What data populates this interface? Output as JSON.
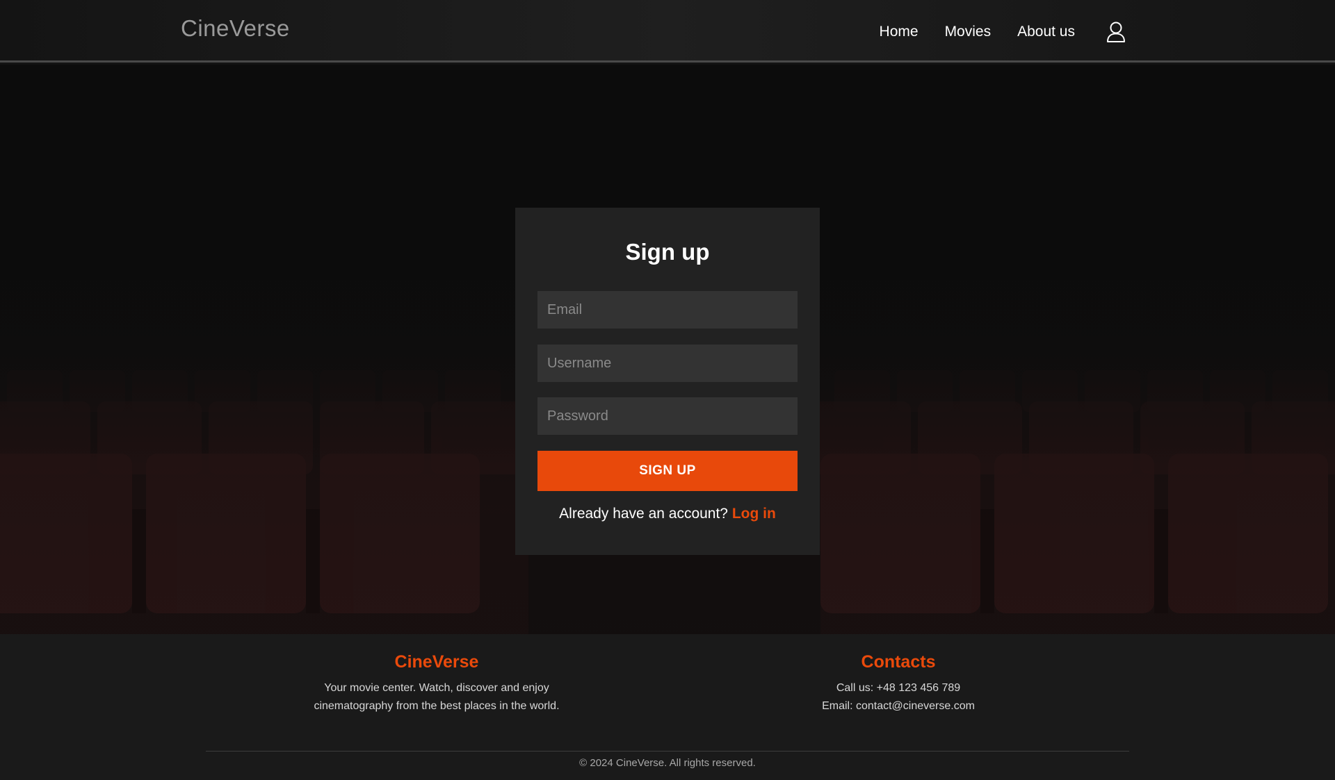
{
  "header": {
    "brand": "CineVerse",
    "nav": {
      "home": "Home",
      "movies": "Movies",
      "about": "About us"
    },
    "user_icon": "user-icon"
  },
  "signup_form": {
    "title": "Sign up",
    "email_placeholder": "Email",
    "username_placeholder": "Username",
    "password_placeholder": "Password",
    "email_value": "",
    "username_value": "",
    "password_value": "",
    "submit_label": "SIGN UP",
    "login_prompt": "Already have an account?",
    "login_link": "Log in"
  },
  "footer": {
    "about": {
      "heading": "CineVerse",
      "text_line1": "Your movie center. Watch, discover and enjoy",
      "text_line2": "cinematography from the best places in the world."
    },
    "contacts": {
      "heading": "Contacts",
      "phone": "Call us: +48 123 456 789",
      "email": "Email: contact@cineverse.com"
    },
    "copyright": "© 2024 CineVerse. All rights reserved."
  },
  "colors": {
    "accent": "#e8490b",
    "background": "#131313",
    "card": "#222222",
    "input": "#333333"
  }
}
